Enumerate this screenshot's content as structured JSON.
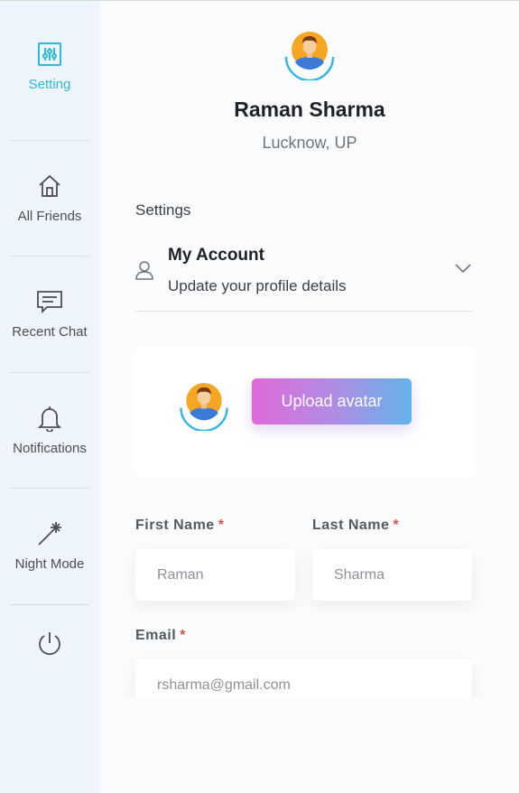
{
  "sidebar": {
    "items": [
      {
        "label": "Setting",
        "icon": "settings-sliders-icon",
        "active": true
      },
      {
        "label": "All Friends",
        "icon": "home-icon"
      },
      {
        "label": "Recent Chat",
        "icon": "chat-icon"
      },
      {
        "label": "Notifications",
        "icon": "bell-icon"
      },
      {
        "label": "Night Mode",
        "icon": "magic-wand-icon"
      },
      {
        "label": "",
        "icon": "power-icon"
      }
    ],
    "accent": "#2fb8dd"
  },
  "profile": {
    "name": "Raman Sharma",
    "location": "Lucknow, UP"
  },
  "settings": {
    "section_label": "Settings",
    "account": {
      "title": "My Account",
      "subtitle": "Update your profile details"
    },
    "upload_label": "Upload avatar"
  },
  "form": {
    "first_name": {
      "label": "First Name",
      "value": "Raman"
    },
    "last_name": {
      "label": "Last Name",
      "value": "Sharma"
    },
    "email": {
      "label": "Email",
      "value": "rsharma@gmail.com"
    },
    "required_mark": "*"
  }
}
